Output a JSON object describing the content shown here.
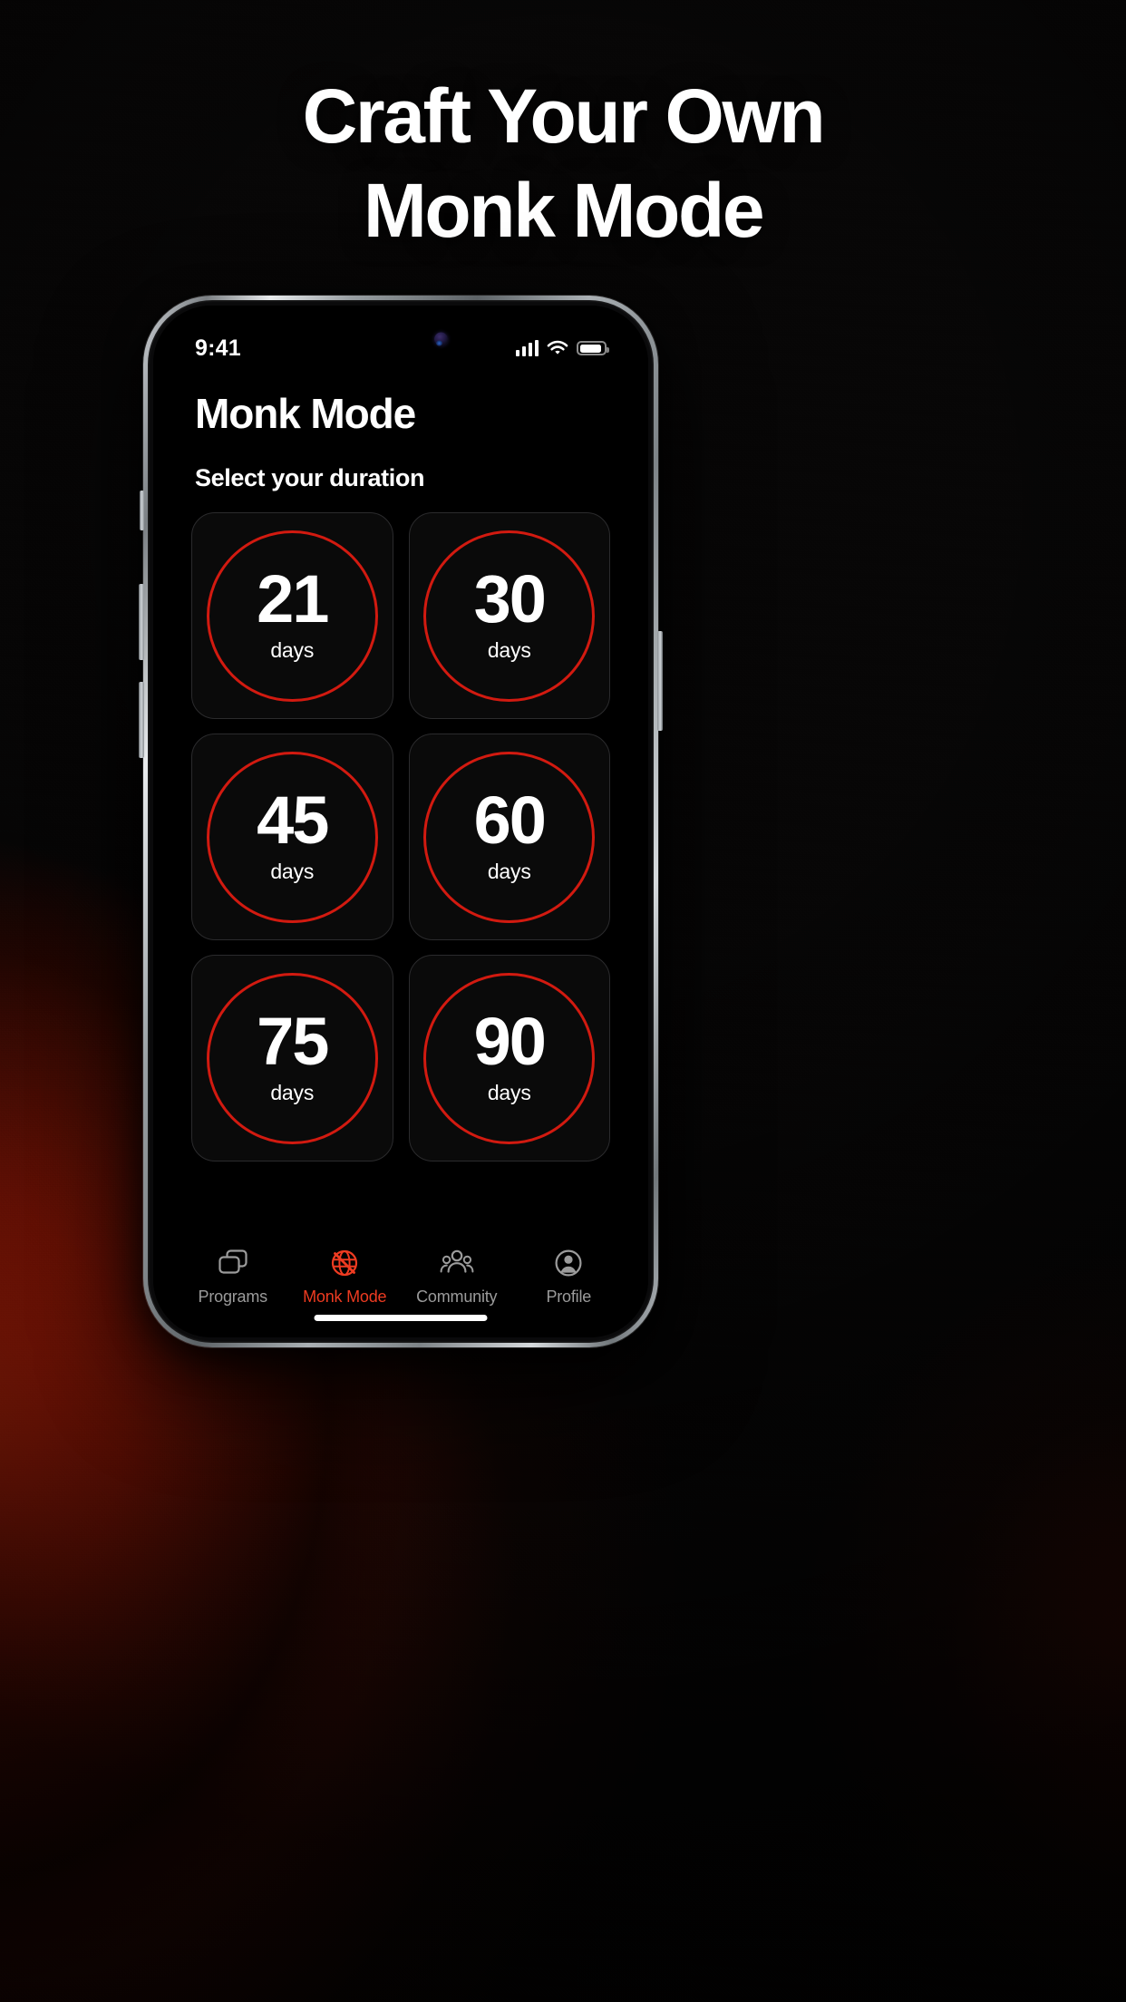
{
  "headline": {
    "line1": "Craft Your Own",
    "line2": "Monk Mode"
  },
  "colors": {
    "accent_red": "#d21a10",
    "tab_active": "#ee3b21",
    "tab_inactive": "#9b9b9b",
    "screen_bg": "#000000",
    "card_bg": "#0a0a0a",
    "card_border": "#2b2b2d",
    "text_primary": "#ffffff"
  },
  "phone": {
    "status_bar": {
      "time": "9:41",
      "icons": [
        "cellular-signal-icon",
        "wifi-icon",
        "battery-icon"
      ]
    },
    "home_indicator": "home-indicator"
  },
  "screen": {
    "title": "Monk Mode",
    "subtitle": "Select your duration",
    "durations": [
      {
        "value": "21",
        "unit": "days"
      },
      {
        "value": "30",
        "unit": "days"
      },
      {
        "value": "45",
        "unit": "days"
      },
      {
        "value": "60",
        "unit": "days"
      },
      {
        "value": "75",
        "unit": "days"
      },
      {
        "value": "90",
        "unit": "days"
      }
    ],
    "tabs": [
      {
        "label": "Programs",
        "icon": "windows-stack-icon",
        "active": false
      },
      {
        "label": "Monk Mode",
        "icon": "globe-slash-icon",
        "active": true
      },
      {
        "label": "Community",
        "icon": "people-group-icon",
        "active": false
      },
      {
        "label": "Profile",
        "icon": "person-circle-icon",
        "active": false
      }
    ]
  }
}
